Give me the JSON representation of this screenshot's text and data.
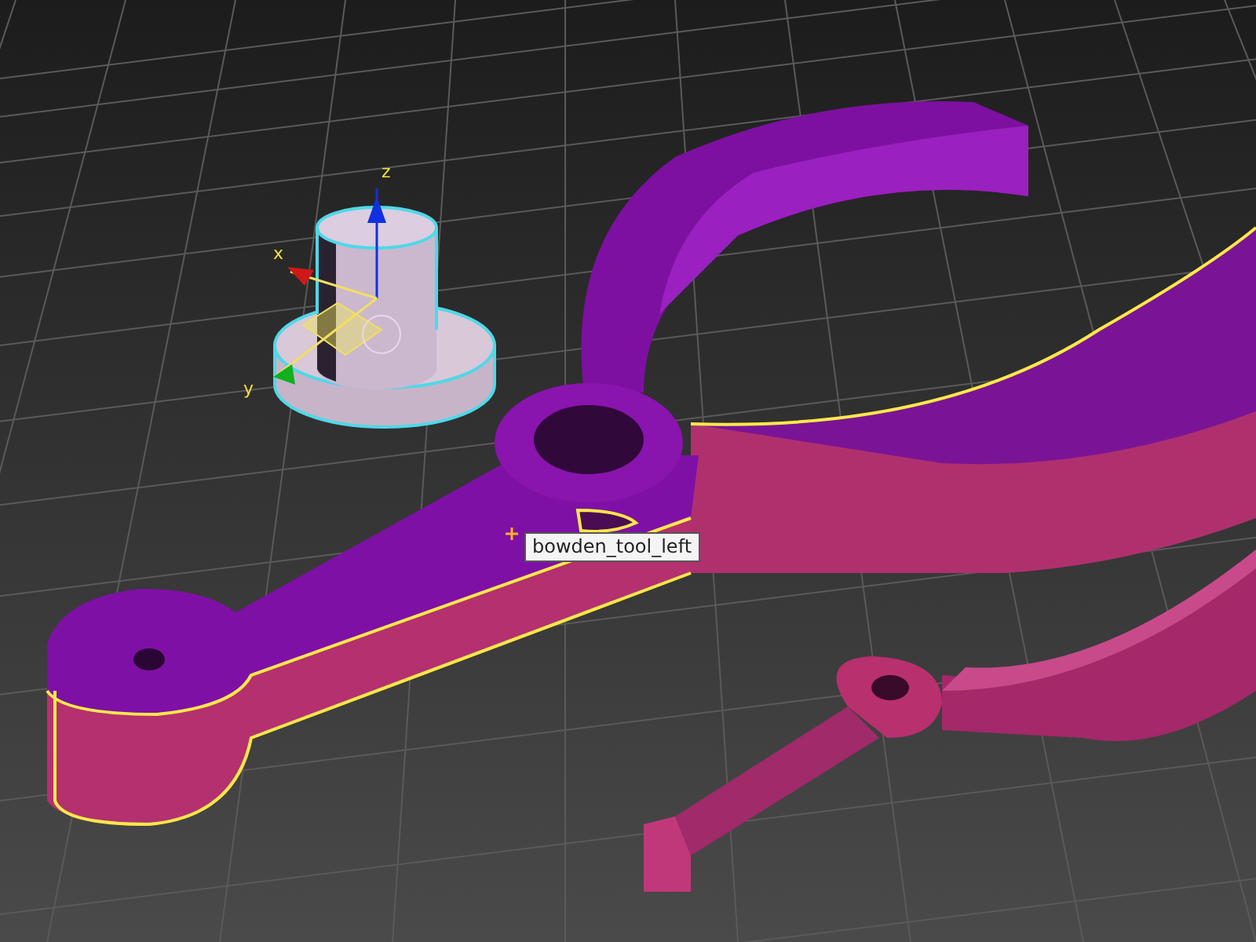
{
  "viewport": {
    "tooltip": "bowden_tool_left",
    "gizmo": {
      "axes": [
        {
          "label": "z",
          "color": "#1030e0"
        },
        {
          "label": "x",
          "color": "#d01818"
        },
        {
          "label": "y",
          "color": "#10b020"
        }
      ]
    }
  }
}
